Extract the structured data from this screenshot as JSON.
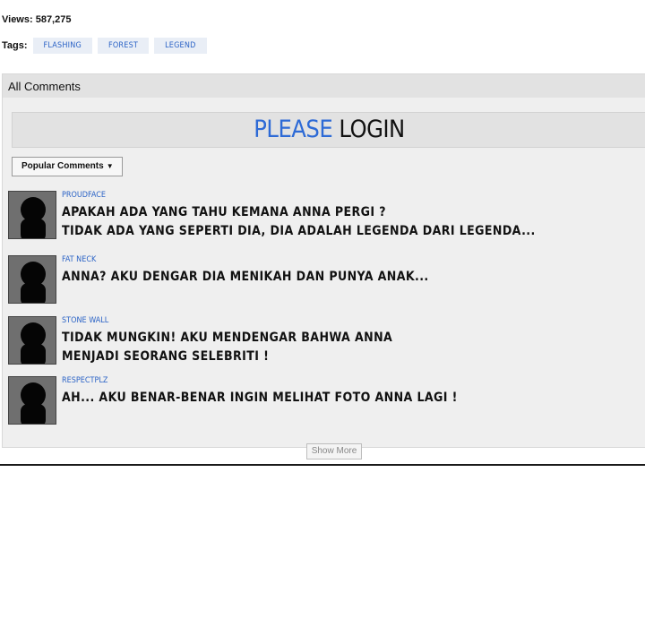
{
  "stats": {
    "views_text": "Views: 587,275"
  },
  "tags": {
    "label": "Tags:",
    "items": [
      "FLASHING",
      "FOREST",
      "LEGEND"
    ]
  },
  "comments_panel": {
    "title": "All Comments",
    "login_please": "PLEASE",
    "login_word": " LOGIN",
    "sort_label": "Popular Comments",
    "show_more": "Show More"
  },
  "comments": [
    {
      "user": "PROUDFACE",
      "lines": [
        "APAKAH ADA YANG TAHU KEMANA ANNA PERGI ?",
        "TIDAK ADA YANG SEPERTI DIA, DIA ADALAH LEGENDA DARI LEGENDA..."
      ]
    },
    {
      "user": "FAT NECK",
      "lines": [
        "ANNA? AKU DENGAR DIA MENIKAH DAN PUNYA ANAK..."
      ]
    },
    {
      "user": "STONE WALL",
      "lines": [
        "TIDAK MUNGKIN! AKU MENDENGAR BAHWA ANNA",
        "MENJADI SEORANG SELEBRITI !"
      ]
    },
    {
      "user": "RESPECTPLZ",
      "lines": [
        "AH... AKU BENAR-BENAR INGIN MELIHAT FOTO ANNA LAGI !"
      ]
    }
  ],
  "icons": {
    "avatar": "default-user-silhouette-icon",
    "sort_caret": "caret-down-icon"
  },
  "colors": {
    "link": "#2b63c6",
    "login_accent": "#2d6ad6",
    "panel_bg": "#efefef"
  }
}
